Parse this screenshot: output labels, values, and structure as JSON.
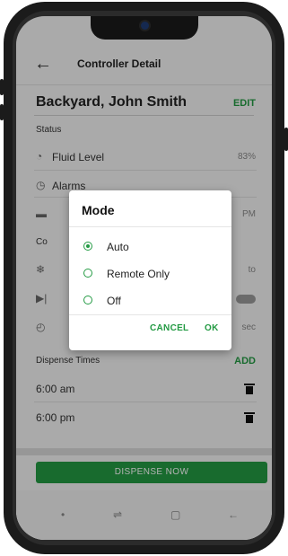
{
  "header": {
    "title": "Controller Detail",
    "back_icon": "arrow-left-icon"
  },
  "controller": {
    "name": "Backyard, John Smith",
    "edit_label": "EDIT"
  },
  "status": {
    "section_label": "Status",
    "fluid_level": {
      "label": "Fluid Level",
      "value": "83%"
    },
    "alarms": {
      "label": "Alarms"
    },
    "partial_time_suffix": "PM"
  },
  "controls_partial": {
    "section_label_prefix": "Co",
    "mode_value_suffix": "to",
    "duration_suffix": "sec"
  },
  "dispense": {
    "section_label": "Dispense Times",
    "add_label": "ADD",
    "times": [
      "6:00 am",
      "6:00 pm"
    ]
  },
  "dispense_button_label": "DISPENSE NOW",
  "dialog": {
    "title": "Mode",
    "options": [
      {
        "label": "Auto",
        "selected": true
      },
      {
        "label": "Remote Only",
        "selected": false
      },
      {
        "label": "Off",
        "selected": false
      }
    ],
    "cancel_label": "CANCEL",
    "ok_label": "OK"
  },
  "colors": {
    "accent": "#239a43",
    "overlay": "rgba(0,0,0,0.30)"
  }
}
